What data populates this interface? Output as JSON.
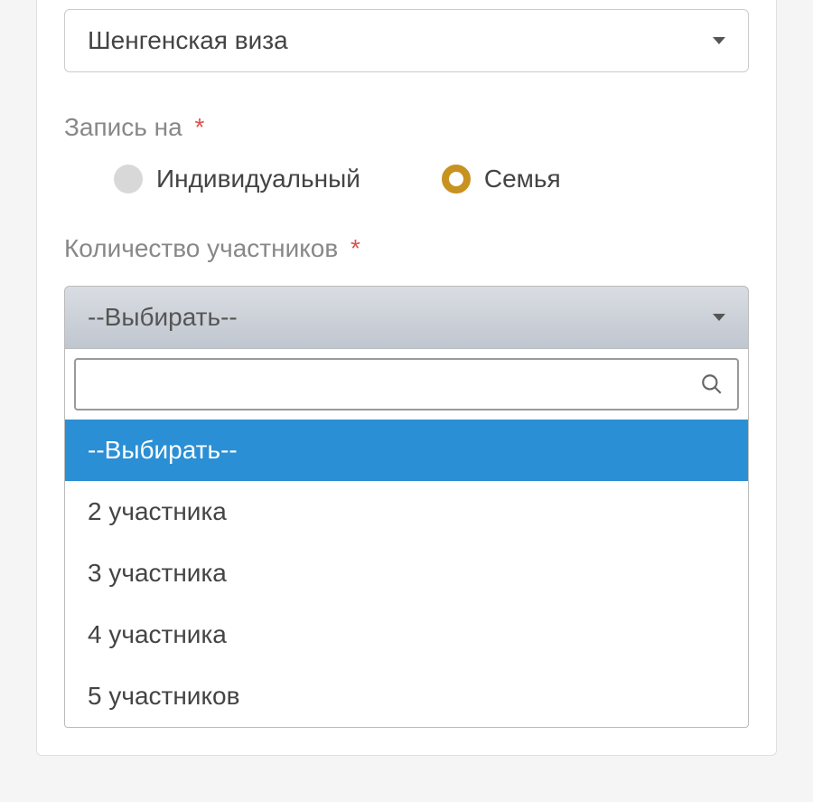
{
  "visa_type": {
    "selected": "Шенгенская виза"
  },
  "booking_for": {
    "label": "Запись на",
    "required_mark": "*",
    "options": {
      "individual": "Индивидуальный",
      "family": "Семья"
    },
    "selected": "family"
  },
  "participants": {
    "label": "Количество участников",
    "required_mark": "*",
    "placeholder": "--Выбирать--",
    "search_value": "",
    "options": [
      "--Выбирать--",
      "2 участника",
      "3 участника",
      "4 участника",
      "5 участников"
    ],
    "highlighted_index": 0
  }
}
